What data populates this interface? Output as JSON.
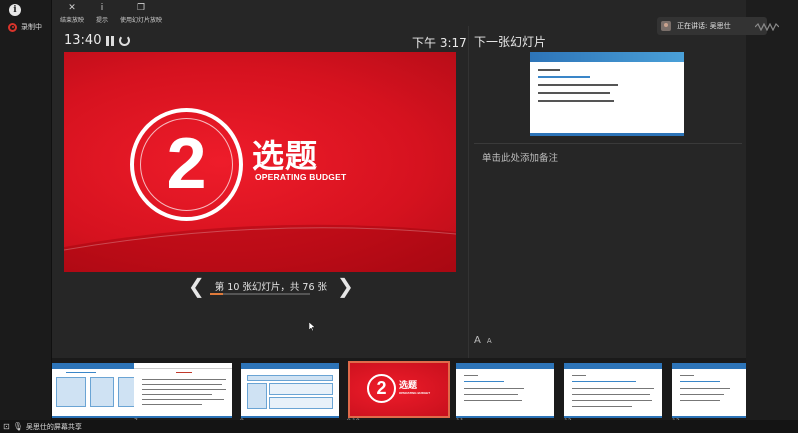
{
  "left_panel": {
    "info_icon": "i",
    "recording_label": "录制中"
  },
  "toolbar": {
    "items": [
      {
        "icon": "✕",
        "label": "结束放映"
      },
      {
        "icon": "i",
        "label": "提示"
      },
      {
        "icon": "❐",
        "label": "使用幻灯片放映"
      }
    ]
  },
  "speaker": {
    "text": "正在讲话: 吴思仕"
  },
  "presenter": {
    "elapsed_time": "13:40",
    "clock": "下午 3:17",
    "next_label": "下一张幻灯片",
    "notes_placeholder": "单击此处添加备注",
    "font_increase": "A",
    "font_decrease": "A",
    "prev_arrow": "❮",
    "next_arrow": "❯",
    "slide_counter": "第 10 张幻灯片，共 76 张",
    "progress_fraction": 0.13
  },
  "current_slide": {
    "number": "2",
    "title": "选题",
    "subtitle": "OPERATING BUDGET"
  },
  "next_slide": {
    "lines": [
      "1 “选题”",
      "——学术价值（人文学科的意义）",
      "从目前学者的研究方法来看",
      "从前期的研究成果来看",
      "从国内外学术研究现状来看"
    ]
  },
  "filmstrip": {
    "thumbs": [
      {
        "num": "7",
        "type": "table"
      },
      {
        "num": "8",
        "type": "text"
      },
      {
        "num": "9",
        "type": "table"
      },
      {
        "num": "10",
        "type": "current",
        "digit": "2",
        "title": "选题",
        "subtitle": "OPERATING BUDGET"
      },
      {
        "num": "11",
        "type": "text"
      },
      {
        "num": "12",
        "type": "text"
      },
      {
        "num": "13",
        "type": "text"
      }
    ]
  },
  "status": {
    "text": "吴思仕的屏幕共享"
  },
  "colors": {
    "slide_red": "#e0141f",
    "progress": "#e07a3a",
    "recording": "#d9342b"
  }
}
